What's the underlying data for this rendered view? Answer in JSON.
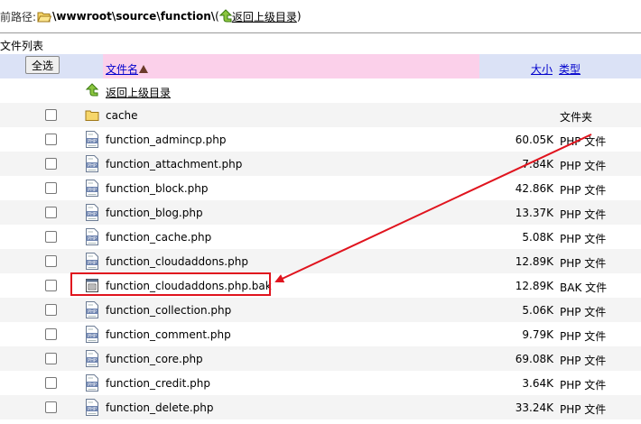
{
  "path": {
    "label": "前路径:",
    "current": "\\wwwroot\\source\\function\\",
    "paren_open": "(",
    "up_link": "返回上级目录",
    "paren_close": ")"
  },
  "list_title": "文件列表",
  "header": {
    "select_all": "全选",
    "name": "文件名",
    "size": "大小",
    "type": "类型"
  },
  "up_row": {
    "label": "返回上级目录"
  },
  "rows": [
    {
      "name": "cache",
      "size": "",
      "type": "文件夹",
      "icon": "folder-icon"
    },
    {
      "name": "function_admincp.php",
      "size": "60.05K",
      "type": "PHP 文件",
      "icon": "php-file-icon"
    },
    {
      "name": "function_attachment.php",
      "size": "7.84K",
      "type": "PHP 文件",
      "icon": "php-file-icon"
    },
    {
      "name": "function_block.php",
      "size": "42.86K",
      "type": "PHP 文件",
      "icon": "php-file-icon"
    },
    {
      "name": "function_blog.php",
      "size": "13.37K",
      "type": "PHP 文件",
      "icon": "php-file-icon"
    },
    {
      "name": "function_cache.php",
      "size": "5.08K",
      "type": "PHP 文件",
      "icon": "php-file-icon"
    },
    {
      "name": "function_cloudaddons.php",
      "size": "12.89K",
      "type": "PHP 文件",
      "icon": "php-file-icon"
    },
    {
      "name": "function_cloudaddons.php.bak",
      "size": "12.89K",
      "type": "BAK 文件",
      "icon": "bak-file-icon"
    },
    {
      "name": "function_collection.php",
      "size": "5.06K",
      "type": "PHP 文件",
      "icon": "php-file-icon"
    },
    {
      "name": "function_comment.php",
      "size": "9.79K",
      "type": "PHP 文件",
      "icon": "php-file-icon"
    },
    {
      "name": "function_core.php",
      "size": "69.08K",
      "type": "PHP 文件",
      "icon": "php-file-icon"
    },
    {
      "name": "function_credit.php",
      "size": "3.64K",
      "type": "PHP 文件",
      "icon": "php-file-icon"
    },
    {
      "name": "function_delete.php",
      "size": "33.24K",
      "type": "PHP 文件",
      "icon": "php-file-icon"
    }
  ],
  "colors": {
    "header_blue": "#dbe2f6",
    "header_pink": "#fbd0ea",
    "link_blue": "#0000cc",
    "annotation_red": "#e0141e"
  }
}
